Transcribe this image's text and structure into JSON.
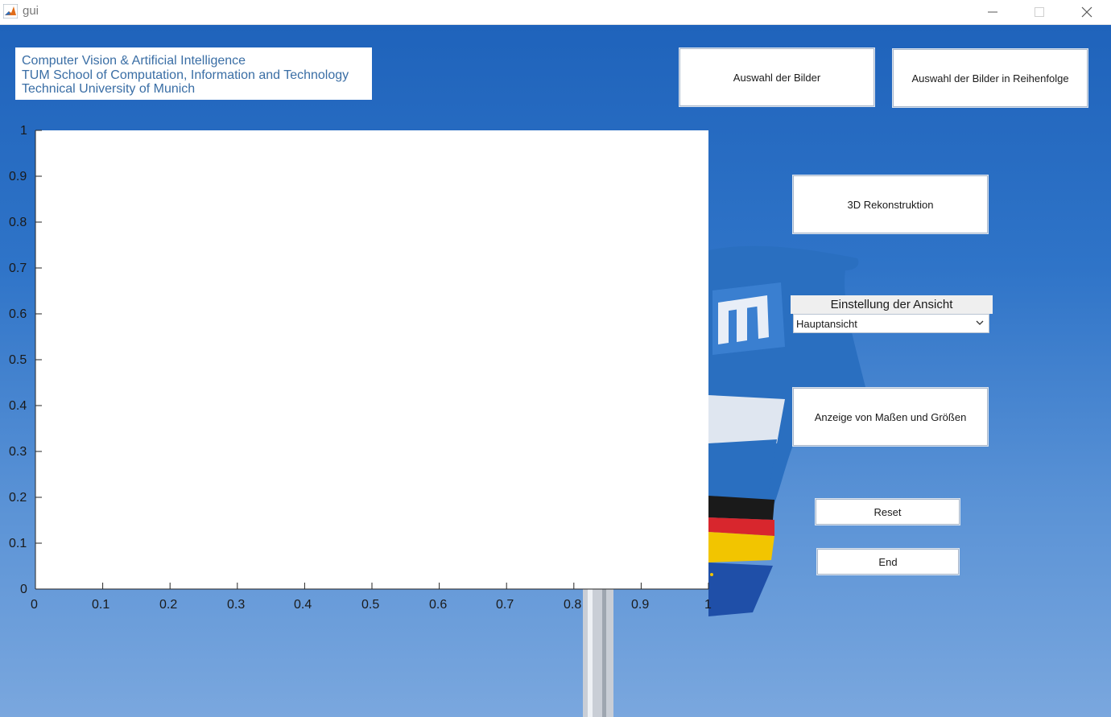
{
  "window": {
    "title": "gui",
    "icon": "matlab-icon",
    "controls": [
      "minimize-icon",
      "maximize-icon",
      "close-icon"
    ]
  },
  "info": {
    "line1": "Computer Vision & Artificial Intelligence",
    "line2": "TUM School of Computation, Information and Technology",
    "line3": "Technical University of Munich"
  },
  "buttons": {
    "select_images": "Auswahl der Bilder",
    "select_images_sequence": "Auswahl der Bilder in Reihenfolge",
    "reconstruction_3d": "3D Rekonstruktion",
    "show_measurements": "Anzeige von Maßen und Größen",
    "reset": "Reset",
    "end": "End"
  },
  "view_setting": {
    "label": "Einstellung der Ansicht",
    "selected": "Hauptansicht"
  },
  "plot": {
    "x_ticks": [
      "0",
      "0.1",
      "0.2",
      "0.3",
      "0.4",
      "0.5",
      "0.6",
      "0.7",
      "0.8",
      "0.9",
      "1"
    ],
    "y_ticks": [
      "0",
      "0.1",
      "0.2",
      "0.3",
      "0.4",
      "0.5",
      "0.6",
      "0.7",
      "0.8",
      "0.9",
      "1"
    ]
  },
  "colors": {
    "background_top": "#1f63bb",
    "info_text": "#3a6ea5",
    "flag_blue": "#2a6fc0",
    "flag_red": "#d8262d",
    "flag_gold": "#f2c500",
    "flag_black": "#1a1a1a"
  }
}
